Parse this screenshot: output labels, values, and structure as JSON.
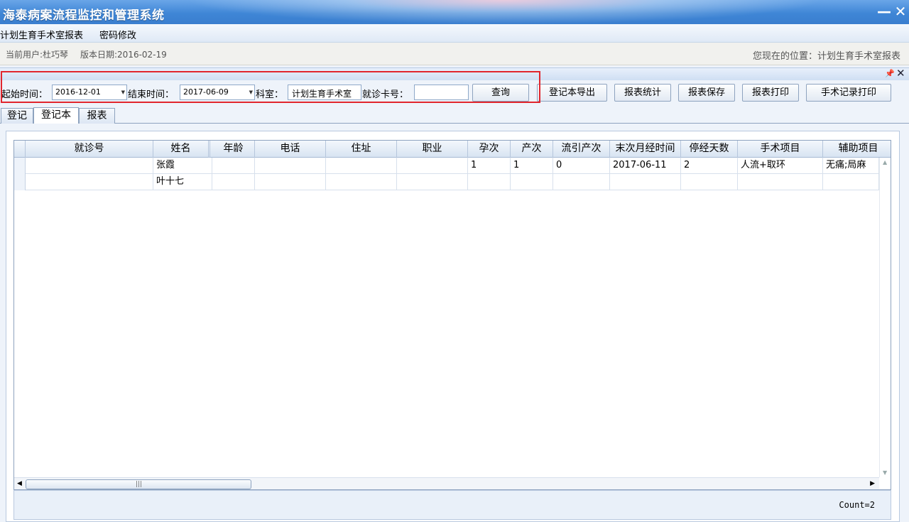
{
  "window": {
    "title": "海泰病案流程监控和管理系统",
    "minimize_glyph": "—",
    "close_glyph": "✕"
  },
  "menu": {
    "items": [
      "计划生育手术室报表",
      "密码修改"
    ]
  },
  "status": {
    "current_user": "当前用户:杜巧琴",
    "version_date": "版本日期:2016-02-19",
    "location": "您现在的位置：计划生育手术室报表"
  },
  "toolbar": {
    "start_label": "起始时间：",
    "start_value": "2016-12-01",
    "end_label": "结束时间：",
    "end_value": "2017-06-09",
    "dept_label": "科室：",
    "dept_value": "计划生育手术室",
    "card_label": "就诊卡号：",
    "card_value": "",
    "query_button": "查询",
    "export_button": "登记本导出",
    "stats_button": "报表统计",
    "save_button": "报表保存",
    "print_button": "报表打印",
    "surgery_print_button": "手术记录打印"
  },
  "tabs": [
    "登记",
    "登记本",
    "报表"
  ],
  "grid": {
    "headers": [
      "就诊号",
      "姓名",
      "年龄",
      "电话",
      "住址",
      "职业",
      "孕次",
      "产次",
      "流引产次",
      "末次月经时间",
      "停经天数",
      "手术项目",
      "辅助项目"
    ],
    "rows": [
      [
        "",
        "张霞",
        "",
        "",
        "",
        "",
        "1",
        "1",
        "0",
        "2017-06-11",
        "2",
        "人流+取环",
        "无痛;局麻"
      ],
      [
        "",
        "叶十七",
        "",
        "",
        "",
        "",
        "",
        "",
        "",
        "",
        "",
        "",
        ""
      ]
    ]
  },
  "footer": {
    "count": "Count=2"
  }
}
